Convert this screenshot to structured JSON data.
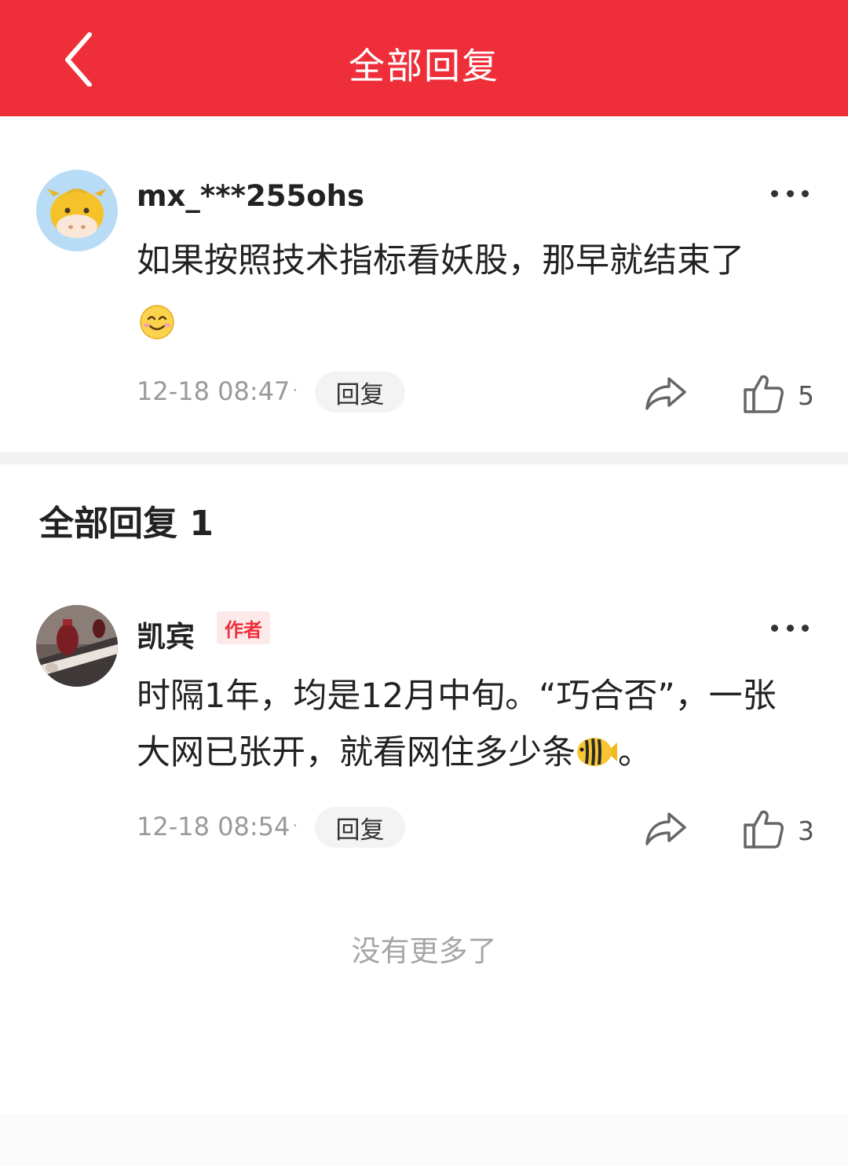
{
  "header": {
    "title": "全部回复",
    "background": "#ee2f3a"
  },
  "main_comment": {
    "username": "mx_***255ohs",
    "text": "如果按照技术指标看妖股，那早就结束了",
    "emoji": "smile-emoji",
    "time": "12-18 08:47",
    "separator": "·",
    "reply_label": "回复",
    "like_count": "5"
  },
  "replies_section": {
    "title": "全部回复 1"
  },
  "replies": [
    {
      "username": "凯宾",
      "badge": "作者",
      "text_line1": "时隔1年，均是12月中旬。“巧合否”，一张",
      "text_line2": "大网已张开，就看网住多少条",
      "text_end": "。",
      "emoji": "fish-emoji",
      "time": "12-18 08:54",
      "separator": "·",
      "reply_label": "回复",
      "like_count": "3"
    }
  ],
  "footer": {
    "no_more_text": "没有更多了"
  }
}
